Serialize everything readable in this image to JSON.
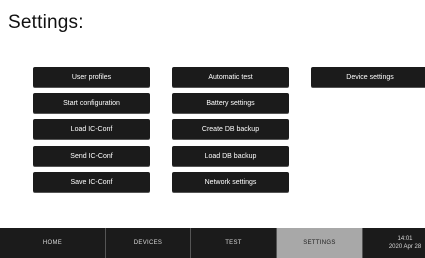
{
  "page": {
    "title": "Settings:"
  },
  "buttons": {
    "user_profiles": "User profiles",
    "start_configuration": "Start configuration",
    "load_ic_conf": "Load IC-Conf",
    "send_ic_conf": "Send IC-Conf",
    "save_ic_conf": "Save IC-Conf",
    "automatic_test": "Automatic test",
    "battery_settings": "Battery settings",
    "create_db_backup": "Create DB backup",
    "load_db_backup": "Load DB backup",
    "network_settings": "Network settings",
    "device_settings": "Device settings"
  },
  "nav": {
    "home": "HOME",
    "devices": "DEVICES",
    "test": "TEST",
    "settings": "SETTINGS",
    "active": "SETTINGS"
  },
  "clock": {
    "time": "14:01",
    "date": "2020 Apr 28"
  },
  "colors": {
    "button_bg": "#1b1b1b",
    "navbar_bg": "#1b1b1b",
    "nav_active_bg": "#a8a8a8"
  }
}
